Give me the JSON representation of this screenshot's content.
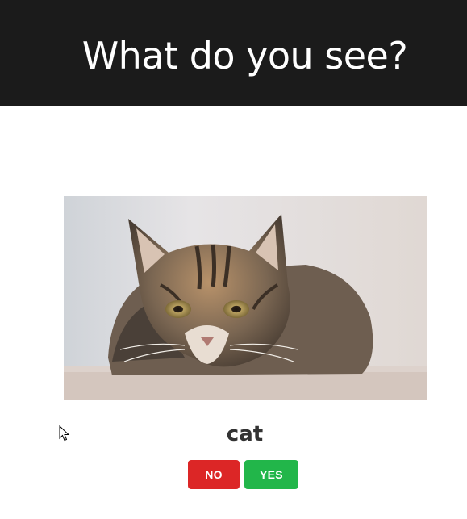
{
  "header": {
    "title": "What do you see?",
    "background_color": "#1b1b1b"
  },
  "main": {
    "image": {
      "subject": "tabby cat lying down"
    },
    "caption": "cat",
    "buttons": {
      "no": {
        "label": "NO",
        "color": "#dc2626"
      },
      "yes": {
        "label": "YES",
        "color": "#22b64a"
      }
    }
  },
  "cursor": {
    "icon": "arrow-pointer-icon"
  }
}
